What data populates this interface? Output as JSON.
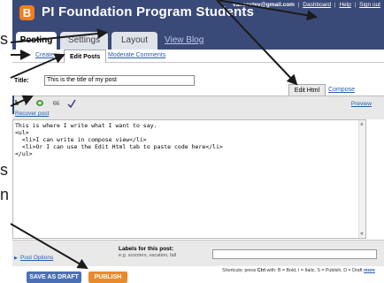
{
  "side_fragments": [
    "s",
    "s",
    "n"
  ],
  "header": {
    "logo_letter": "B",
    "blog_title": "PI Foundation Program Students",
    "email": "vancestev@gmail.com",
    "links": [
      "Dashboard",
      "Help",
      "Sign out"
    ]
  },
  "tabs": {
    "posting": "Posting",
    "settings": "Settings",
    "layout": "Layout",
    "view_blog": "View Blog"
  },
  "subtabs": {
    "create": "Create",
    "edit_posts": "Edit Posts",
    "moderate": "Moderate Comments"
  },
  "editor": {
    "title_label": "Title:",
    "title_value": "This is the title of my post",
    "mode_html": "Edit Html",
    "mode_compose": "Compose",
    "toolbar": {
      "bold": "b",
      "italic": "i",
      "quote": "66"
    },
    "recover": "Recover post",
    "preview": "Preview",
    "body_lines": [
      "This is where I write what I want to say.",
      "<ul>",
      "  <li>I can write in compose view</li>",
      "  <li>Or I can use the Edit Html tab to paste code here</li>",
      "</ul>"
    ],
    "post_options": "Post Options",
    "labels_title": "Labels for this post:",
    "labels_hint": "e.g. scooters, vacation, fall",
    "shortcuts_prefix": "Shortcuts: press ",
    "shortcuts_ctrl": "Ctrl",
    "shortcuts_with": " with: ",
    "shortcuts_keys": "B = Bold, I = Italic, S = Publish, D = Draft",
    "shortcuts_more": "more"
  },
  "buttons": {
    "save_draft": "SAVE AS DRAFT",
    "publish": "PUBLISH"
  },
  "colors": {
    "header_bg": "#3a4a78",
    "logo": "#f07e1f",
    "link": "#2a5db0",
    "save_btn": "#4a6fb5",
    "publish_btn": "#e98a2c",
    "arrow": "#1b1b1b"
  }
}
